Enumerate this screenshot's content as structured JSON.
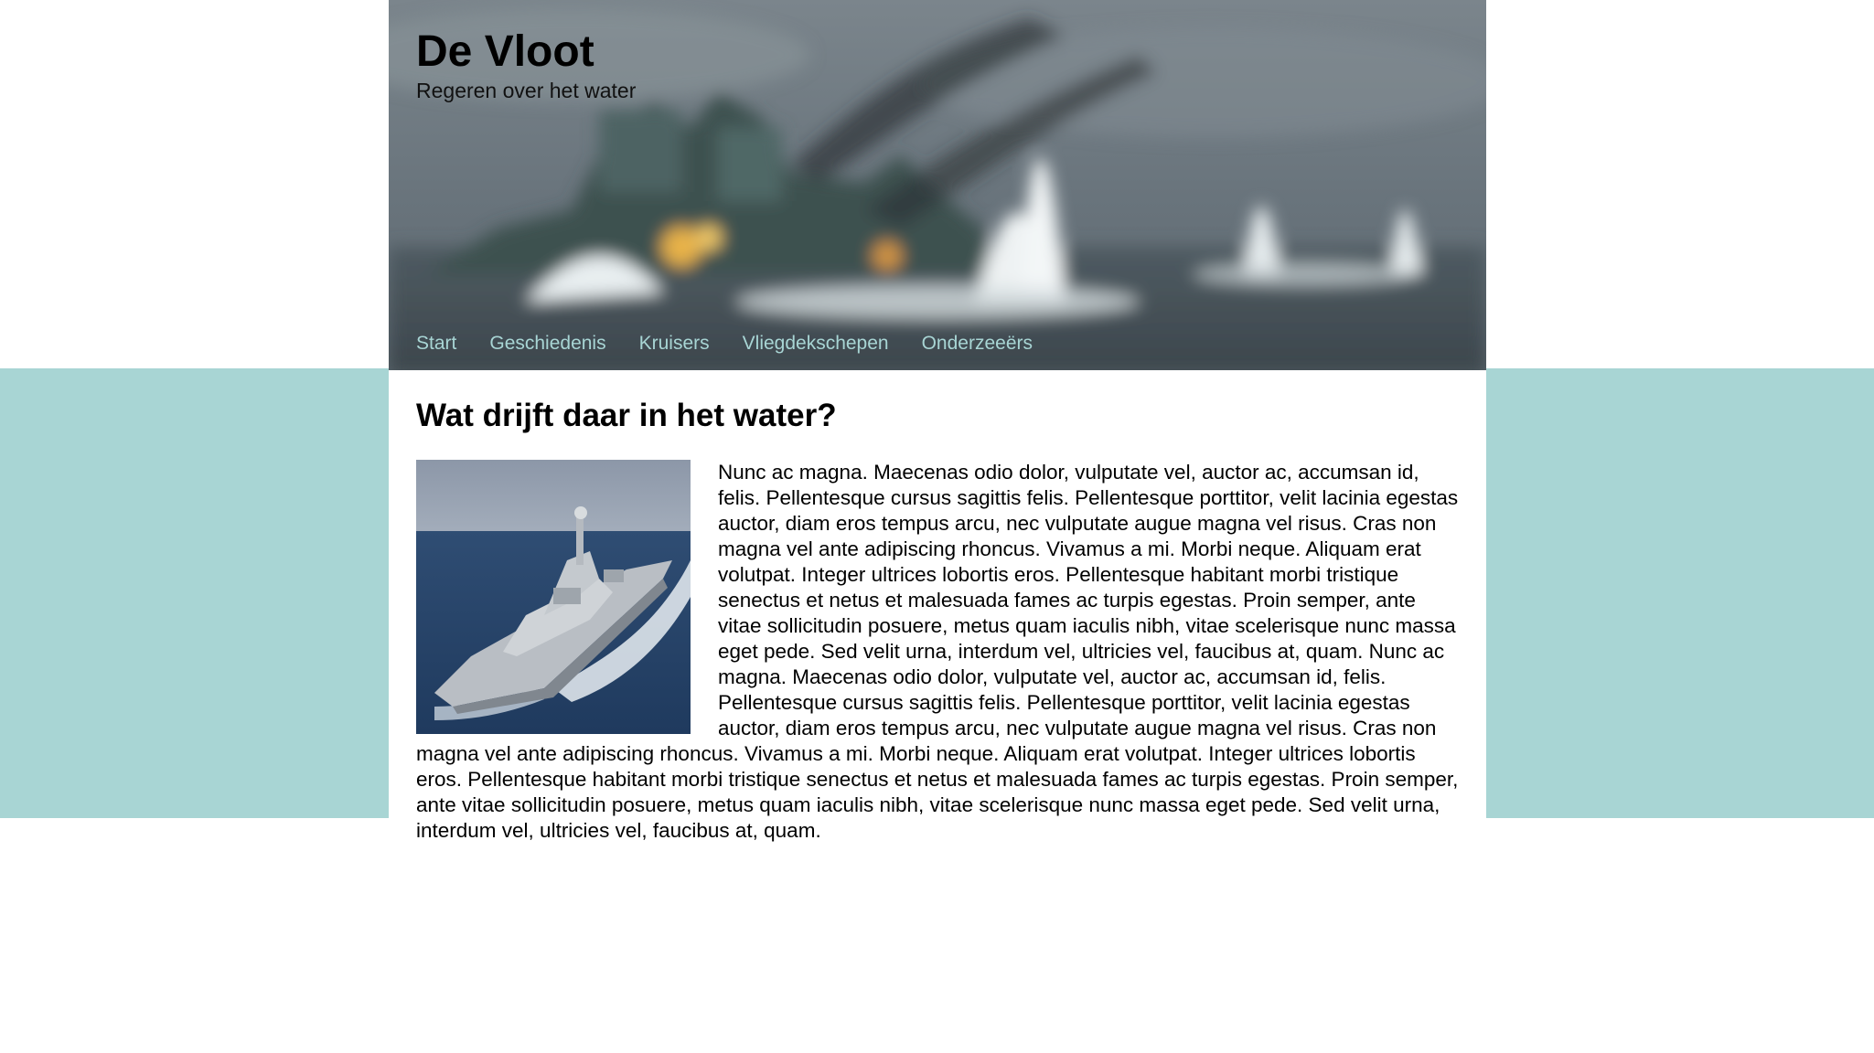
{
  "header": {
    "title": "De Vloot",
    "tagline": "Regeren over het water",
    "background_image": "blurred warship in battle at sea"
  },
  "nav": {
    "items": [
      {
        "label": "Start"
      },
      {
        "label": "Geschiedenis"
      },
      {
        "label": "Kruisers"
      },
      {
        "label": "Vliegdekschepen"
      },
      {
        "label": "Onderzeeërs"
      }
    ]
  },
  "main": {
    "heading": "Wat drijft daar in het water?",
    "image": "frigate sailing at sea",
    "paragraph": "Nunc ac magna. Maecenas odio dolor, vulputate vel, auctor ac, accumsan id, felis. Pellentesque cursus sagittis felis. Pellentesque porttitor, velit lacinia egestas auctor, diam eros tempus arcu, nec vulputate augue magna vel risus. Cras non magna vel ante adipiscing rhoncus. Vivamus a mi. Morbi neque. Aliquam erat volutpat. Integer ultrices lobortis eros. Pellentesque habitant morbi tristique senectus et netus et malesuada fames ac turpis egestas. Proin semper, ante vitae sollicitudin posuere, metus quam iaculis nibh, vitae scelerisque nunc massa eget pede. Sed velit urna, interdum vel, ultricies vel, faucibus at, quam. Nunc ac magna. Maecenas odio dolor, vulputate vel, auctor ac, accumsan id, felis. Pellentesque cursus sagittis felis. Pellentesque porttitor, velit lacinia egestas auctor, diam eros tempus arcu, nec vulputate augue magna vel risus. Cras non magna vel ante adipiscing rhoncus. Vivamus a mi. Morbi neque. Aliquam erat volutpat. Integer ultrices lobortis eros. Pellentesque habitant morbi tristique senectus et netus et malesuada fames ac turpis egestas. Proin semper, ante vitae sollicitudin posuere, metus quam iaculis nibh, vitae scelerisque nunc massa eget pede. Sed velit urna, interdum vel, ultricies vel, faucibus at, quam."
  },
  "colors": {
    "accent_teal": "#a8d5d4",
    "nav_link": "#a8d5d4",
    "text": "#000000",
    "background": "#ffffff"
  }
}
